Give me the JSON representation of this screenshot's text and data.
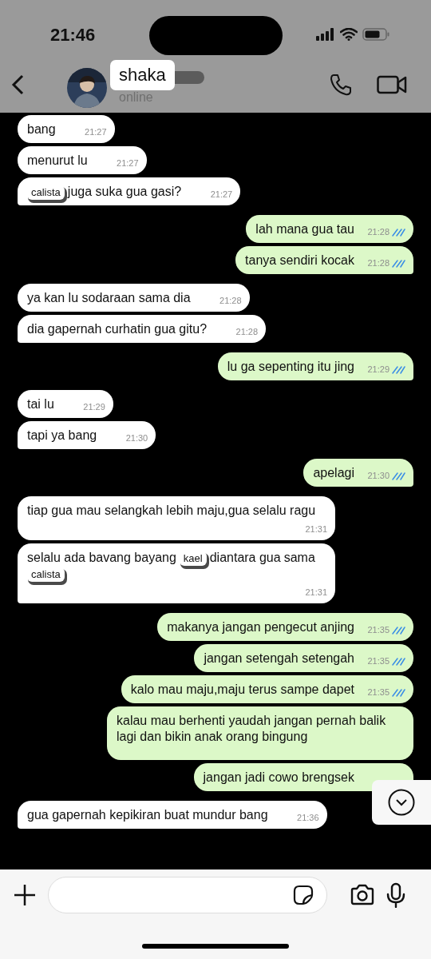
{
  "status_bar": {
    "time": "21:46"
  },
  "header": {
    "name": "shaka",
    "status": "online"
  },
  "messages": [
    {
      "kind": "incoming",
      "parts": [
        {
          "kind": "text",
          "text": "bang"
        }
      ],
      "time": "21:27"
    },
    {
      "kind": "incoming",
      "parts": [
        {
          "kind": "text",
          "text": "menurut lu"
        }
      ],
      "time": "21:27"
    },
    {
      "kind": "incoming",
      "parts": [
        {
          "kind": "tag",
          "text": "calista"
        },
        {
          "kind": "text",
          "text": "juga suka gua gasi?"
        }
      ],
      "time": "21:27"
    },
    {
      "kind": "outgoing",
      "parts": [
        {
          "kind": "text",
          "text": "lah mana gua tau"
        }
      ],
      "time": "21:28",
      "read": true
    },
    {
      "kind": "outgoing",
      "parts": [
        {
          "kind": "text",
          "text": "tanya sendiri kocak"
        }
      ],
      "time": "21:28",
      "read": true
    },
    {
      "kind": "incoming",
      "parts": [
        {
          "kind": "text",
          "text": "ya kan lu sodaraan sama dia"
        }
      ],
      "time": "21:28"
    },
    {
      "kind": "incoming",
      "parts": [
        {
          "kind": "text",
          "text": "dia gapernah curhatin gua gitu?"
        }
      ],
      "time": "21:28"
    },
    {
      "kind": "outgoing",
      "parts": [
        {
          "kind": "text",
          "text": "lu ga sepenting itu jing"
        }
      ],
      "time": "21:29",
      "read": true
    },
    {
      "kind": "incoming",
      "parts": [
        {
          "kind": "text",
          "text": "tai lu"
        }
      ],
      "time": "21:29"
    },
    {
      "kind": "incoming",
      "parts": [
        {
          "kind": "text",
          "text": "tapi ya bang"
        }
      ],
      "time": "21:30"
    },
    {
      "kind": "outgoing",
      "parts": [
        {
          "kind": "text",
          "text": "apelagi"
        }
      ],
      "time": "21:30",
      "read": true
    },
    {
      "kind": "incoming",
      "parts": [
        {
          "kind": "text",
          "text": "tiap gua mau selangkah lebih maju,gua selalu ragu"
        }
      ],
      "time": "21:31"
    },
    {
      "kind": "incoming",
      "parts": [
        {
          "kind": "text",
          "text": "selalu ada bavang bayang"
        },
        {
          "kind": "tag",
          "text": "kael"
        },
        {
          "kind": "text",
          "text": "diantara gua"
        },
        {
          "kind": "text",
          "text": "sama"
        },
        {
          "kind": "tag",
          "text": "calista"
        }
      ],
      "time": "21:31"
    },
    {
      "kind": "outgoing",
      "parts": [
        {
          "kind": "text",
          "text": "makanya jangan pengecut anjing"
        }
      ],
      "time": "21:35",
      "read": true
    },
    {
      "kind": "outgoing",
      "parts": [
        {
          "kind": "text",
          "text": "jangan setengah setengah"
        }
      ],
      "time": "21:35",
      "read": true
    },
    {
      "kind": "outgoing",
      "parts": [
        {
          "kind": "text",
          "text": "kalo mau maju,maju terus sampe dapet"
        }
      ],
      "time": "21:35",
      "read": true
    },
    {
      "kind": "outgoing",
      "parts": [
        {
          "kind": "text",
          "text": "kalau mau berhenti yaudah jangan pernah balik lagi dan bikin anak orang bingung"
        }
      ]
    },
    {
      "kind": "outgoing",
      "parts": [
        {
          "kind": "text",
          "text": "jangan jadi cowo brengsek"
        }
      ]
    },
    {
      "kind": "incoming",
      "parts": [
        {
          "kind": "text",
          "text": "gua gapernah kepikiran buat mundur bang"
        }
      ],
      "time": "21:36"
    }
  ]
}
